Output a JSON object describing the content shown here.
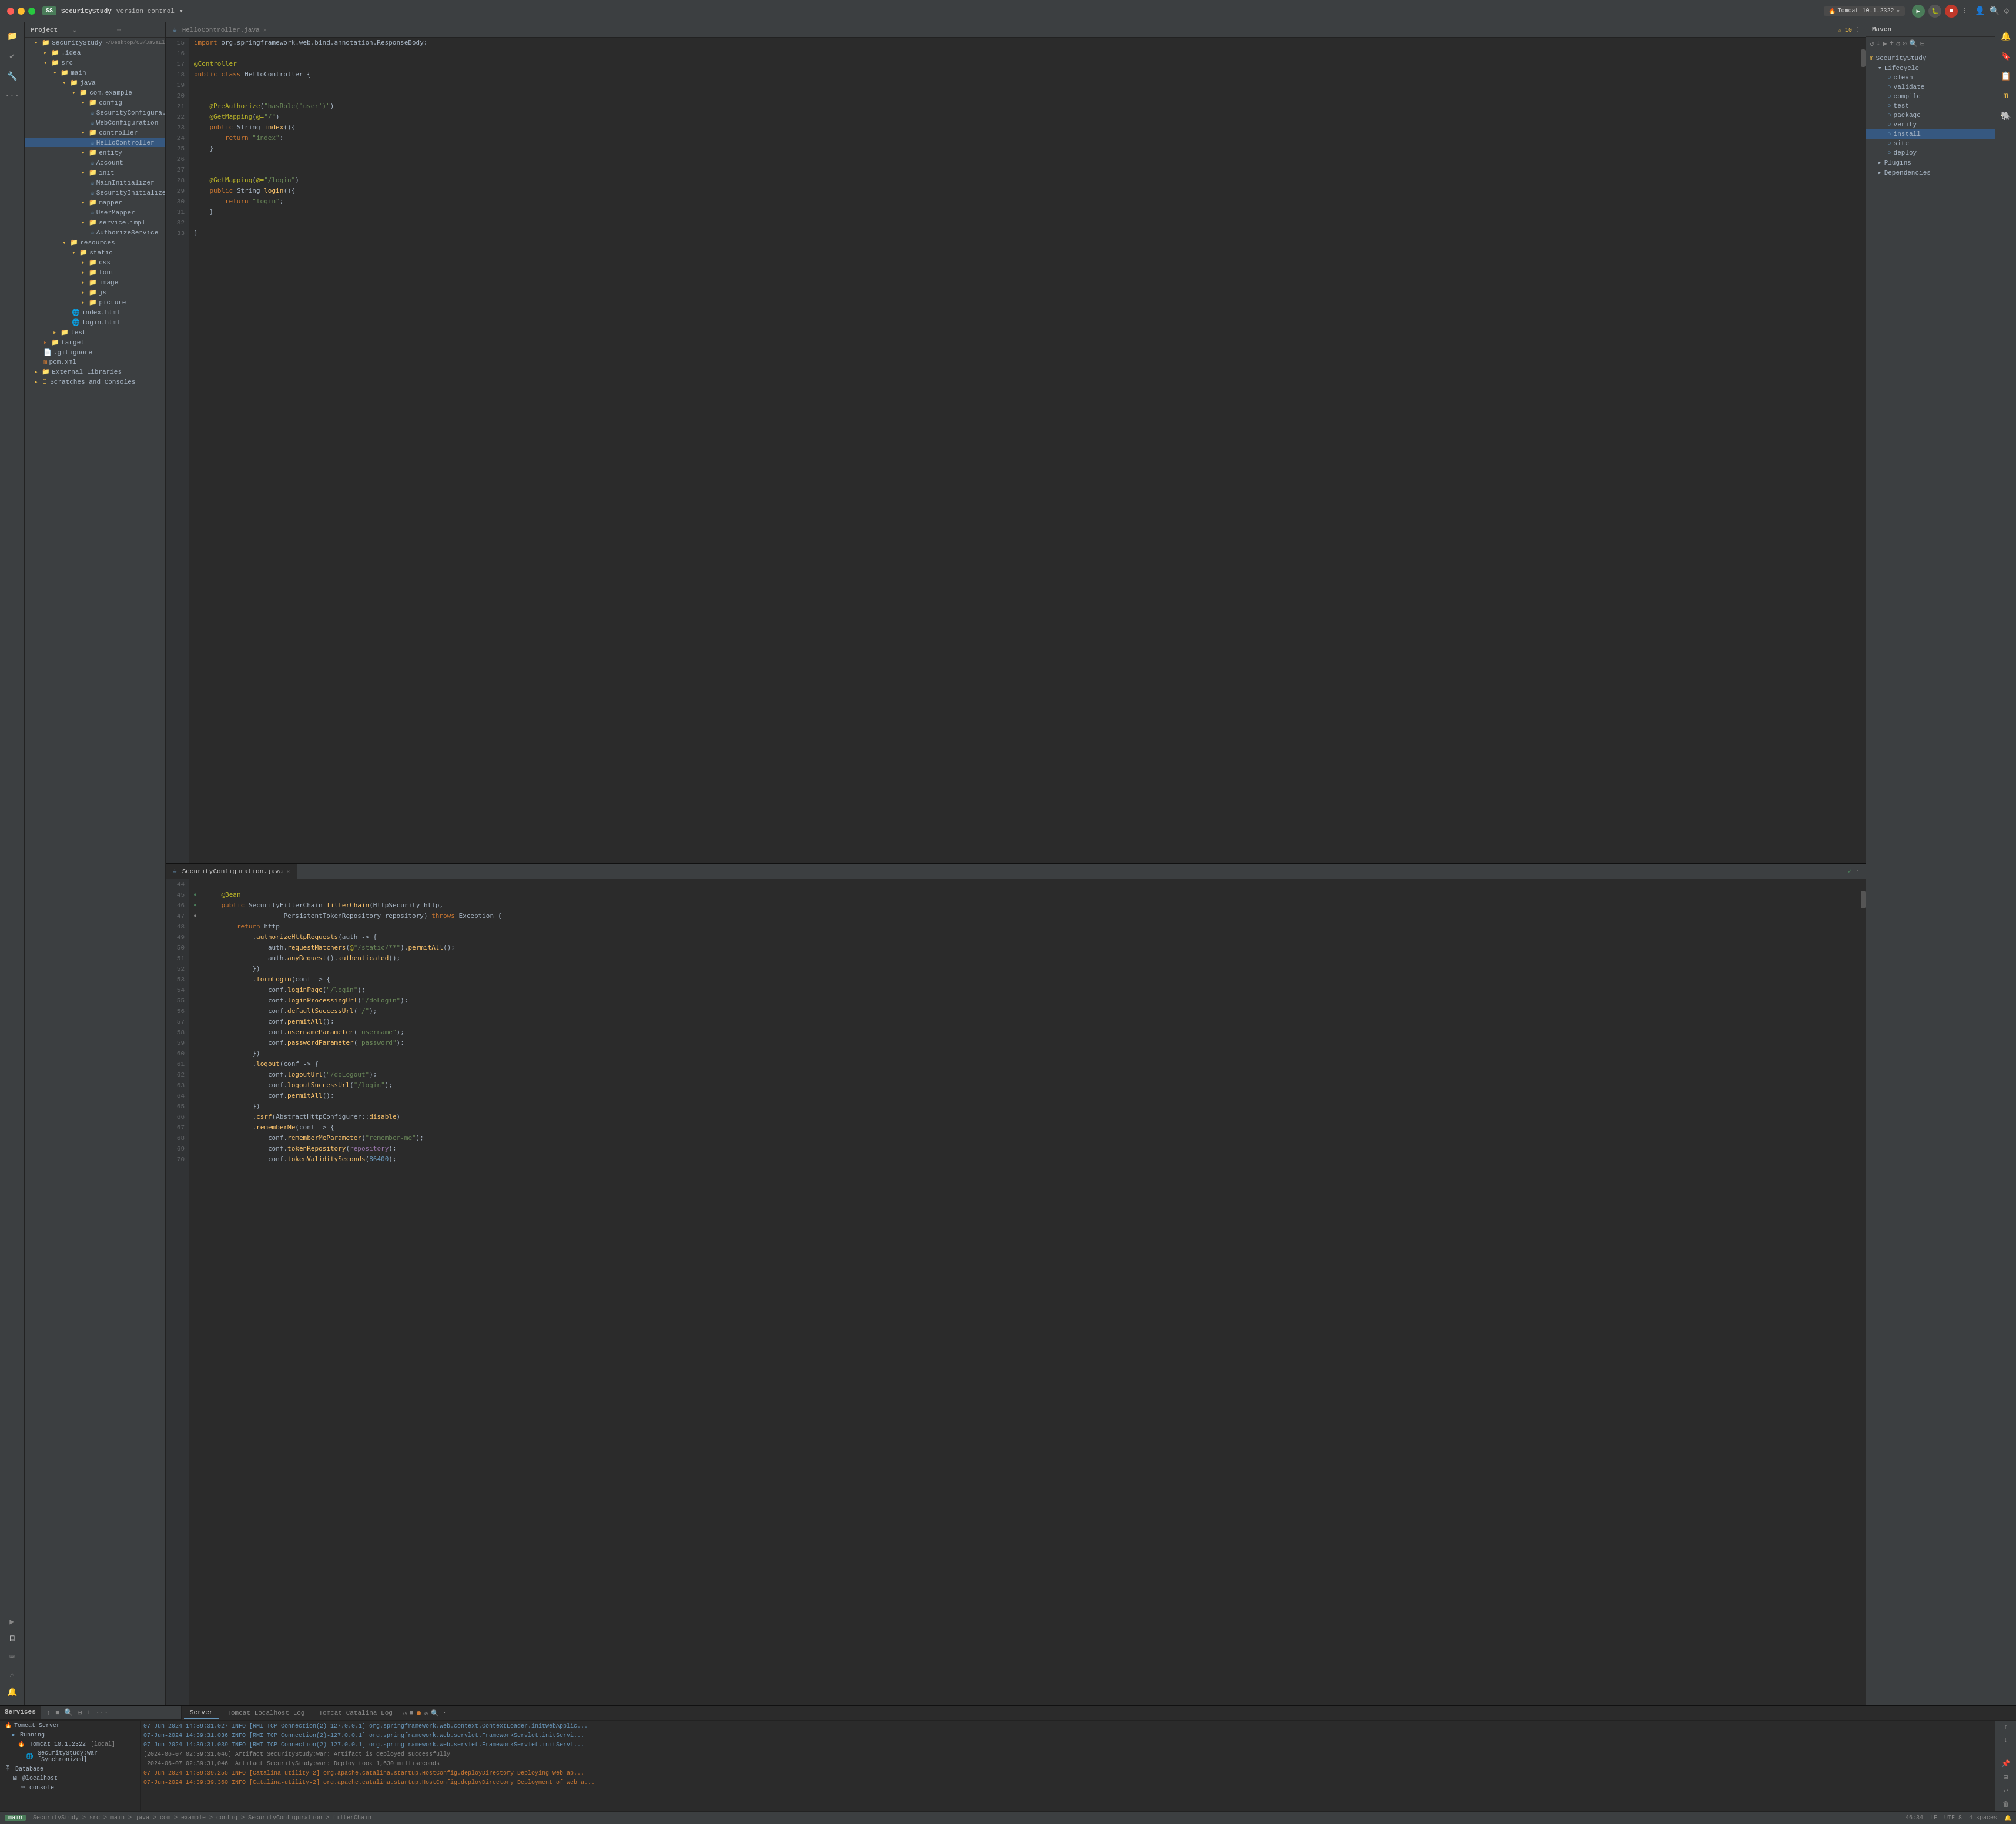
{
  "titlebar": {
    "project_badge": "SS",
    "project_name": "SecurityStudy",
    "project_suffix": "~/Desktop/CS/JavaEl...",
    "version_control": "Version control",
    "run_config": "Tomcat 10.1.2322",
    "run_config_arrow": "▾"
  },
  "editor": {
    "tabs": [
      {
        "id": "tab1",
        "label": "HelloController.java",
        "active": false,
        "icon": "☕"
      },
      {
        "id": "tab2",
        "label": "SecurityConfiguration.java",
        "active": true,
        "icon": "☕"
      }
    ]
  },
  "hello_controller_code": [
    {
      "ln": "15",
      "text": "    import org.springframework.web.bind.annotation.ResponseBody;"
    },
    {
      "ln": "16",
      "text": ""
    },
    {
      "ln": "17",
      "text": "    @Controller"
    },
    {
      "ln": "18",
      "text": "    public class HelloController {"
    },
    {
      "ln": "19",
      "text": ""
    },
    {
      "ln": "20",
      "text": ""
    },
    {
      "ln": "21",
      "text": "        @PreAuthorize(\"hasRole('user')\")"
    },
    {
      "ln": "22",
      "text": "        @GetMapping(@=\"/\")"
    },
    {
      "ln": "23",
      "text": "        public String index(){"
    },
    {
      "ln": "24",
      "text": "            return \"index\";"
    },
    {
      "ln": "25",
      "text": "        }"
    },
    {
      "ln": "26",
      "text": ""
    },
    {
      "ln": "27",
      "text": ""
    },
    {
      "ln": "28",
      "text": "        @GetMapping(@=\"/login\")"
    },
    {
      "ln": "29",
      "text": "        public String login(){"
    },
    {
      "ln": "30",
      "text": "            return \"login\";"
    },
    {
      "ln": "31",
      "text": "        }"
    },
    {
      "ln": "32",
      "text": ""
    },
    {
      "ln": "33",
      "text": "    }"
    }
  ],
  "security_config_code": [
    {
      "ln": "44",
      "text": ""
    },
    {
      "ln": "45",
      "text": "    @Bean",
      "has_gutter": true
    },
    {
      "ln": "46",
      "text": "    public SecurityFilterChain filterChain(HttpSecurity http,",
      "has_gutter": true,
      "method_start": true
    },
    {
      "ln": "47",
      "text": "                            PersistentTokenRepository repository) throws Exception {",
      "has_gutter": true
    },
    {
      "ln": "48",
      "text": "        return http"
    },
    {
      "ln": "49",
      "text": "            .authorizeHttpRequests(auth -> {"
    },
    {
      "ln": "50",
      "text": "                auth.requestMatchers(@\"/static/**\").permitAll();"
    },
    {
      "ln": "51",
      "text": "                auth.anyRequest().authenticated();"
    },
    {
      "ln": "52",
      "text": "            })"
    },
    {
      "ln": "53",
      "text": "            .formLogin(conf -> {"
    },
    {
      "ln": "54",
      "text": "                conf.loginPage(\"/login\");"
    },
    {
      "ln": "55",
      "text": "                conf.loginProcessingUrl(\"/doLogin\");"
    },
    {
      "ln": "56",
      "text": "                conf.defaultSuccessUrl(\"/\");"
    },
    {
      "ln": "57",
      "text": "                conf.permitAll();"
    },
    {
      "ln": "58",
      "text": "                conf.usernameParameter(\"username\");"
    },
    {
      "ln": "59",
      "text": "                conf.passwordParameter(\"password\");"
    },
    {
      "ln": "60",
      "text": "            })"
    },
    {
      "ln": "61",
      "text": "            .logout(conf -> {"
    },
    {
      "ln": "62",
      "text": "                conf.logoutUrl(\"/doLogout\");"
    },
    {
      "ln": "63",
      "text": "                conf.logoutSuccessUrl(\"/login\");"
    },
    {
      "ln": "64",
      "text": "                conf.permitAll();"
    },
    {
      "ln": "65",
      "text": "            })"
    },
    {
      "ln": "66",
      "text": "            .csrf(AbstractHttpConfigurer::disable)"
    },
    {
      "ln": "67",
      "text": "            .rememberMe(conf -> {"
    },
    {
      "ln": "68",
      "text": "                conf.rememberMeParameter(\"remember-me\");"
    },
    {
      "ln": "69",
      "text": "                conf.tokenRepository(repository);"
    },
    {
      "ln": "70",
      "text": "                conf.tokenValiditySeconds(86400);"
    }
  ],
  "project_tree": {
    "root": "SecurityStudy",
    "root_path": "~/Desktop/CS/JavaEl...",
    "items": [
      {
        "id": "idea",
        "label": ".idea",
        "type": "folder",
        "depth": 1,
        "expanded": false
      },
      {
        "id": "src",
        "label": "src",
        "type": "folder",
        "depth": 1,
        "expanded": true
      },
      {
        "id": "main",
        "label": "main",
        "type": "folder",
        "depth": 2,
        "expanded": true
      },
      {
        "id": "java",
        "label": "java",
        "type": "folder",
        "depth": 3,
        "expanded": true
      },
      {
        "id": "com_example",
        "label": "com.example",
        "type": "folder",
        "depth": 4,
        "expanded": true
      },
      {
        "id": "config",
        "label": "config",
        "type": "folder",
        "depth": 5,
        "expanded": true
      },
      {
        "id": "SecurityConfig",
        "label": "SecurityConfigura...",
        "type": "java",
        "depth": 6
      },
      {
        "id": "WebConfiguration",
        "label": "WebConfiguration",
        "type": "java",
        "depth": 6
      },
      {
        "id": "controller",
        "label": "controller",
        "type": "folder",
        "depth": 5,
        "expanded": true
      },
      {
        "id": "HelloController",
        "label": "HelloController",
        "type": "java",
        "depth": 6,
        "selected": true
      },
      {
        "id": "entity",
        "label": "entity",
        "type": "folder",
        "depth": 5,
        "expanded": true
      },
      {
        "id": "Account",
        "label": "Account",
        "type": "java",
        "depth": 6
      },
      {
        "id": "init",
        "label": "init",
        "type": "folder",
        "depth": 5,
        "expanded": true
      },
      {
        "id": "MainInitializer",
        "label": "MainInitializer",
        "type": "java",
        "depth": 6
      },
      {
        "id": "SecurityInitializer",
        "label": "SecurityInitializer",
        "type": "java",
        "depth": 6
      },
      {
        "id": "mapper",
        "label": "mapper",
        "type": "folder",
        "depth": 5,
        "expanded": true
      },
      {
        "id": "UserMapper",
        "label": "UserMapper",
        "type": "java",
        "depth": 6
      },
      {
        "id": "service_impl",
        "label": "service.impl",
        "type": "folder",
        "depth": 5,
        "expanded": true
      },
      {
        "id": "AuthorizeService",
        "label": "AuthorizeService",
        "type": "java",
        "depth": 6
      },
      {
        "id": "resources",
        "label": "resources",
        "type": "folder",
        "depth": 3,
        "expanded": true
      },
      {
        "id": "static",
        "label": "static",
        "type": "folder",
        "depth": 4,
        "expanded": true
      },
      {
        "id": "css",
        "label": "css",
        "type": "folder",
        "depth": 5,
        "expanded": false
      },
      {
        "id": "font",
        "label": "font",
        "type": "folder",
        "depth": 5,
        "expanded": false
      },
      {
        "id": "image",
        "label": "image",
        "type": "folder",
        "depth": 5,
        "expanded": false
      },
      {
        "id": "js",
        "label": "js",
        "type": "folder",
        "depth": 5,
        "expanded": false
      },
      {
        "id": "picture",
        "label": "picture",
        "type": "folder",
        "depth": 5,
        "expanded": false
      },
      {
        "id": "index_html",
        "label": "index.html",
        "type": "html",
        "depth": 4
      },
      {
        "id": "login_html",
        "label": "login.html",
        "type": "html",
        "depth": 4
      },
      {
        "id": "test",
        "label": "test",
        "type": "folder",
        "depth": 2,
        "expanded": false
      },
      {
        "id": "target",
        "label": "target",
        "type": "folder",
        "depth": 1,
        "expanded": false
      },
      {
        "id": "gitignore",
        "label": ".gitignore",
        "type": "git",
        "depth": 1
      },
      {
        "id": "pom_xml",
        "label": "pom.xml",
        "type": "xml",
        "depth": 1
      },
      {
        "id": "external_libs",
        "label": "External Libraries",
        "type": "folder",
        "depth": 1,
        "expanded": false
      },
      {
        "id": "scratches",
        "label": "Scratches and Consoles",
        "type": "folder",
        "depth": 1,
        "expanded": false
      }
    ]
  },
  "maven": {
    "title": "Maven",
    "project_name": "SecurityStudy",
    "lifecycle": {
      "label": "Lifecycle",
      "items": [
        "clean",
        "validate",
        "compile",
        "test",
        "package",
        "verify",
        "install",
        "site",
        "deploy"
      ]
    },
    "plugins": {
      "label": "Plugins"
    },
    "dependencies": {
      "label": "Dependencies"
    },
    "active_item": "install"
  },
  "services": {
    "title": "Services",
    "server": {
      "label": "Tomcat Server",
      "status": "Running",
      "instance": "Tomcat 10.1.2322",
      "instance_label": "[local]",
      "artifact": "SecurityStudy:war [Synchronized]"
    },
    "database": {
      "label": "Database",
      "host": "@localhost",
      "console": "console"
    }
  },
  "log": {
    "tabs": [
      "Server",
      "Tomcat Localhost Log",
      "Tomcat Catalina Log"
    ],
    "active_tab": "Server",
    "lines": [
      {
        "type": "info",
        "text": "07-Jun-2024 14:39:31.027 INFO [RMI TCP Connection(2)-127.0.0.1] org.springframework.web.context.ContextLoader.initWebApplic..."
      },
      {
        "type": "info",
        "text": "07-Jun-2024 14:39:31.036 INFO [RMI TCP Connection(2)-127.0.0.1] org.springframework.web.servlet.FrameworkServlet.initServi..."
      },
      {
        "type": "info",
        "text": "07-Jun-2024 14:39:31.039 INFO [RMI TCP Connection(2)-127.0.0.1] org.springframework.web.servlet.FrameworkServlet.initServl..."
      },
      {
        "type": "success",
        "text": "[2024-06-07 02:39:31,046] Artifact SecurityStudy:war: Artifact is deployed successfully"
      },
      {
        "type": "success",
        "text": "[2024-06-07 02:39:31,046] Artifact SecurityStudy:war: Deploy took 1,630 milliseconds"
      },
      {
        "type": "info_red",
        "text": "07-Jun-2024 14:39:39.255 INFO [Catalina-utility-2] org.apache.catalina.startup.HostConfig.deployDirectory Deploying web ap..."
      },
      {
        "type": "info_red",
        "text": "07-Jun-2024 14:39:39.360 INFO [Catalina-utility-2] org.apache.catalina.startup.HostConfig.deployDirectory Deployment of web a..."
      }
    ]
  },
  "status_bar": {
    "project_path": "SecurityStudy > src > main > java > com > example > config > SecurityConfiguration > filterChain",
    "position": "46:34",
    "line_ending": "LF",
    "encoding": "UTF-8",
    "indent": "4 spaces"
  },
  "icons": {
    "folder_open": "▾📁",
    "folder_closed": "▸📁",
    "java_file": "☕",
    "html_file": "🌐",
    "xml_file": "📄",
    "git_file": "📄",
    "run": "▶",
    "stop": "■",
    "build": "🔨",
    "search": "🔍",
    "gear": "⚙",
    "plus": "+",
    "minus": "−",
    "refresh": "↺",
    "collapse": "⊟"
  }
}
